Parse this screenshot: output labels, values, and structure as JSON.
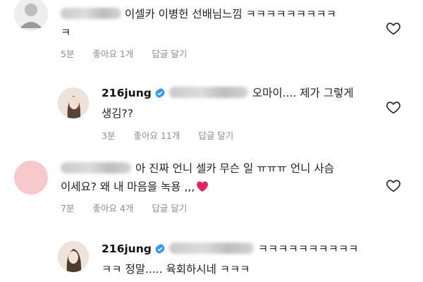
{
  "comments": [
    {
      "line1": "이셀카 이병헌 선배님느낌 ㅋㅋㅋㅋㅋㅋㅋㅋㅋ",
      "line2": "ㅋ",
      "time": "5분",
      "likes": "좋아요 1개",
      "reply": "답글 달기"
    },
    {
      "username": "216jung",
      "line1_end": "오마이.... 제가 그렇게",
      "line2": "생김??",
      "time": "3분",
      "likes": "좋아요 11개",
      "reply": "답글 달기"
    },
    {
      "line1_end": "아 진짜 언니 셀카 무슨 일 ㅠㅠㅠ 언니 사슴",
      "line2": "이세요? 왜 내 마음을 녹용 ,,,",
      "time": "7분",
      "likes": "좋아요 4개",
      "reply": "답글 달기"
    },
    {
      "username": "216jung",
      "line1_end": "ㅋㅋㅋㅋㅋㅋㅋㅋㅋㅋ",
      "line2": "ㅋㅋ 정말..... 육회하시네 ㅋㅋㅋ"
    }
  ],
  "icons": {
    "like": "heart-outline-icon",
    "verified": "verified-badge-icon",
    "emoji": "red-heart-emoji"
  },
  "colors": {
    "meta_text": "#8e8e8e",
    "verified": "#3897f0",
    "emoji_heart": "#e0245e"
  }
}
